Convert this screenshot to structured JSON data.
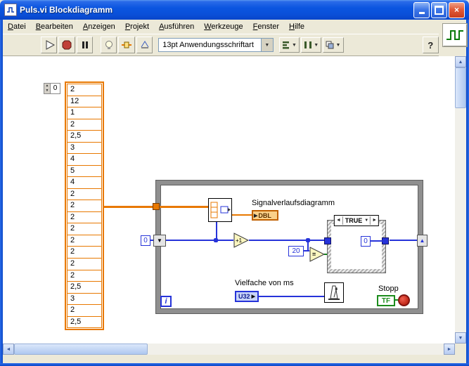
{
  "window": {
    "title": "Puls.vi Blockdiagramm"
  },
  "menu": {
    "items": [
      "Datei",
      "Bearbeiten",
      "Anzeigen",
      "Projekt",
      "Ausführen",
      "Werkzeuge",
      "Fenster",
      "Hilfe"
    ]
  },
  "toolbar": {
    "font_selector": "13pt Anwendungsschriftart",
    "help_label": "?"
  },
  "diagram": {
    "array_constant": {
      "index_value": "0",
      "values": [
        "2",
        "12",
        "1",
        "2",
        "2,5",
        "3",
        "4",
        "5",
        "4",
        "2",
        "2",
        "2",
        "2",
        "2",
        "2",
        "2",
        "2",
        "2,5",
        "3",
        "2",
        "2,5"
      ]
    },
    "loop": {
      "iteration_label": "i"
    },
    "shift_register_init": "0",
    "increment_label": "+1",
    "equals_label": "=",
    "comparison_constant": "20",
    "case": {
      "selector_label": "TRUE",
      "reset_constant": "0"
    },
    "chart": {
      "label": "Signalverlaufsdiagramm",
      "type_label": "DBL"
    },
    "timing": {
      "label": "Vielfache von ms",
      "type_label": "U32"
    },
    "stop": {
      "label": "Stopp",
      "const_label": "TF"
    }
  },
  "icons": {
    "close": "×",
    "dropdown": "▼",
    "sr_left": "▼",
    "sr_right": "▲",
    "case_prev": "◄",
    "case_next": "►",
    "case_down": "▼",
    "index_up": "▲",
    "index_down": "▼",
    "dbl_arrow": "▶",
    "u32_arrow": "▶",
    "scroll_up": "▲",
    "scroll_down": "▼",
    "scroll_left": "◄",
    "scroll_right": "►"
  },
  "colors": {
    "titlebar_blue": "#0A4FD8",
    "window_bg": "#ECE9D8",
    "dbl_orange": "#E87800",
    "int_blue": "#2633D9",
    "bool_green": "#13871B",
    "loop_gray": "#8F8F8F"
  }
}
